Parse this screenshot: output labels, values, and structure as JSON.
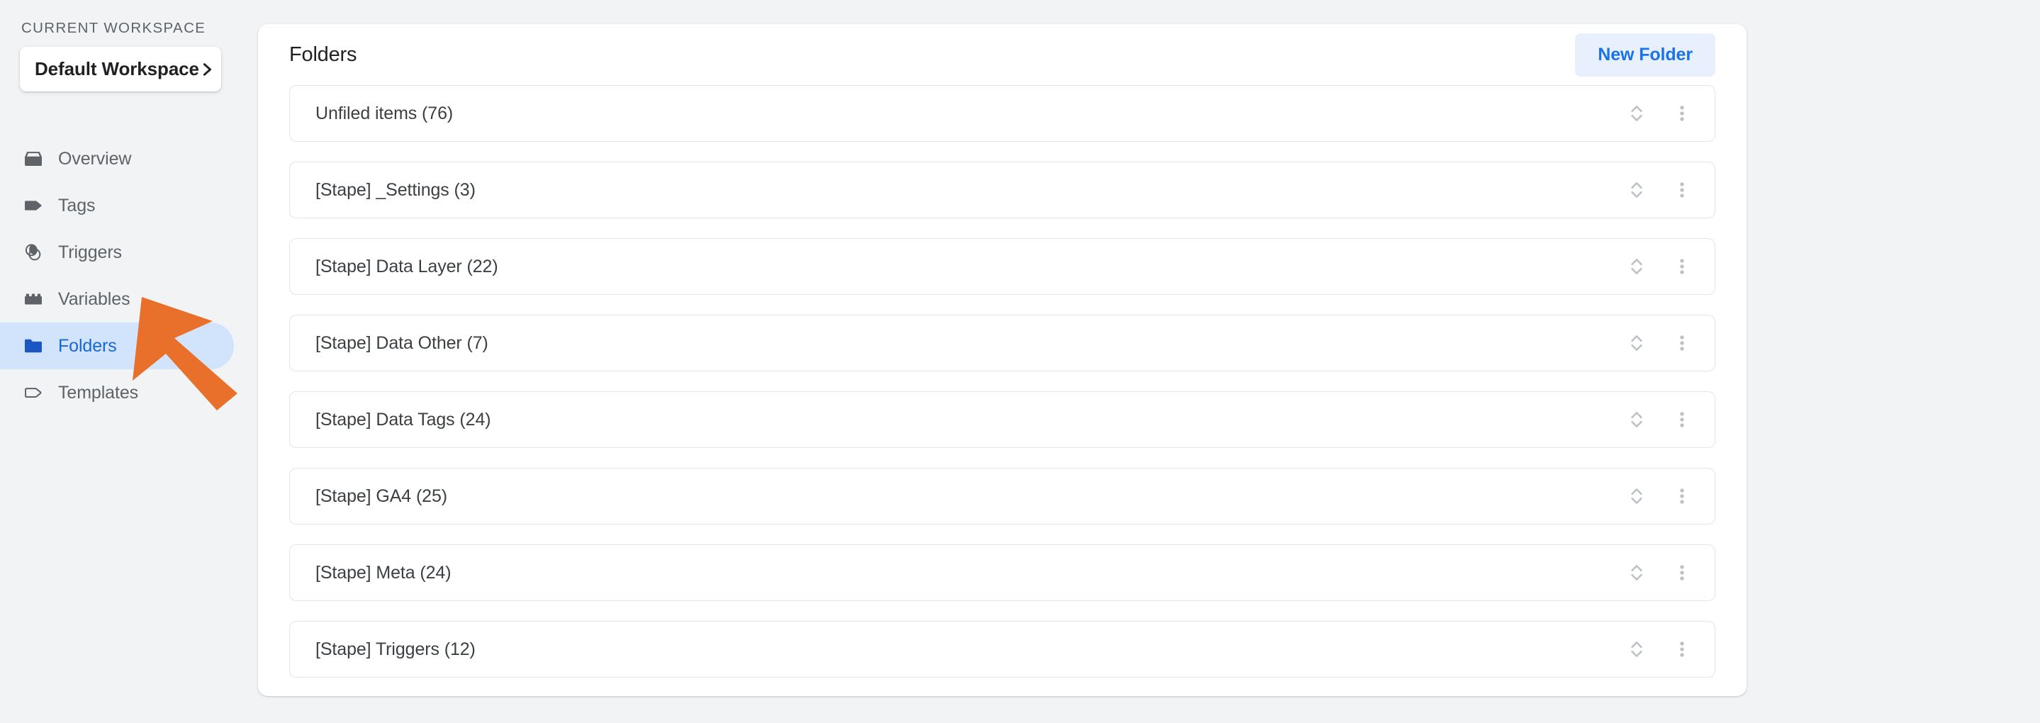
{
  "sidebar": {
    "workspace_label": "CURRENT WORKSPACE",
    "workspace_name": "Default Workspace",
    "chevron_icon": "chevron-right-icon",
    "items": [
      {
        "label": "Overview",
        "icon": "overview-box-icon",
        "active": false
      },
      {
        "label": "Tags",
        "icon": "tag-filled-icon",
        "active": false
      },
      {
        "label": "Triggers",
        "icon": "triggers-circles-icon",
        "active": false
      },
      {
        "label": "Variables",
        "icon": "variables-brick-icon",
        "active": false
      },
      {
        "label": "Folders",
        "icon": "folder-filled-icon",
        "active": true
      },
      {
        "label": "Templates",
        "icon": "template-tag-outline-icon",
        "active": false
      }
    ]
  },
  "main": {
    "title": "Folders",
    "new_folder_label": "New Folder",
    "row_sort_icon": "sort-up-down-icon",
    "row_menu_icon": "more-vertical-icon",
    "folders": [
      {
        "name": "Unfiled items (76)"
      },
      {
        "name": "[Stape] _Settings (3)"
      },
      {
        "name": "[Stape] Data Layer (22)"
      },
      {
        "name": "[Stape] Data Other (7)"
      },
      {
        "name": "[Stape] Data Tags (24)"
      },
      {
        "name": "[Stape] GA4 (25)"
      },
      {
        "name": "[Stape] Meta (24)"
      },
      {
        "name": "[Stape] Triggers (12)"
      }
    ]
  },
  "annotation": {
    "arrow_color": "#e8702a",
    "arrow_icon": "pointer-arrow-annotation"
  },
  "colors": {
    "page_background": "#f1f3f4",
    "card_background": "#ffffff",
    "accent_blue": "#1a73e8",
    "active_nav_background": "#d2e3fc",
    "active_nav_text": "#1967d2",
    "icon_gray": "#5f6368",
    "row_border": "#e3e5e8",
    "annotation_orange": "#e8702a"
  }
}
